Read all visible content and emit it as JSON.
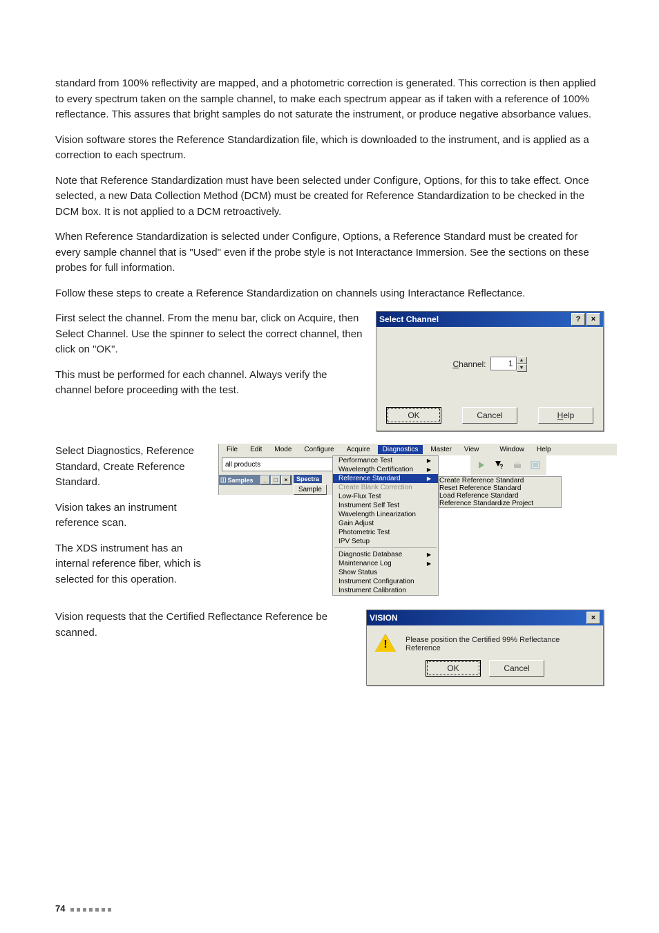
{
  "paragraphs": {
    "p1": "standard from 100% reflectivity are mapped, and a photometric correction is generated. This correction is then applied to every spectrum taken on the sample channel, to make each spectrum appear as if taken with a reference of 100% reflectance. This assures that bright samples do not saturate the instrument, or produce negative absorbance values.",
    "p2": "Vision software stores the Reference Standardization file, which is downloaded to the instrument, and is applied as a correction to each spectrum.",
    "p3": "Note that Reference Standardization must have been selected under Configure, Options, for this to take effect. Once selected, a new Data Collection Method (DCM) must be created for Reference Standardization to be checked in the DCM box. It is not applied to a DCM retroactively.",
    "p4": "When Reference Standardization is selected under Configure, Options, a Reference Standard must be created for every sample channel that is \"Used\" even if the probe style is not Interactance Immersion. See the sections on these probes for full information.",
    "p5": "Follow these steps to create a Reference Standardization on channels using Interactance Reflectance.",
    "p6": "First select the channel. From the menu bar, click on Acquire, then Select Channel. Use the spinner to select the correct channel, then click on \"OK\".",
    "p7": "This must be performed for each channel. Always verify the channel before proceeding with the test.",
    "p8": "Select Diagnostics, Reference Standard, Create Reference Standard.",
    "p9": "Vision takes an instrument reference scan.",
    "p10": "The XDS instrument has an internal reference fiber, which is selected for this operation.",
    "p11": "Vision requests that the Certified Reflectance Reference be scanned."
  },
  "select_channel": {
    "title": "Select Channel",
    "label_pre": "C",
    "label_post": "hannel:",
    "value": "1",
    "ok": "OK",
    "cancel": "Cancel",
    "help_pre": "H",
    "help_post": "elp"
  },
  "app": {
    "menubar": {
      "file": "File",
      "edit": "Edit",
      "mode": "Mode",
      "configure": "Configure",
      "acquire": "Acquire",
      "diagnostics": "Diagnostics",
      "master": "Master",
      "view": "View",
      "window": "Window",
      "help": "Help"
    },
    "combo": "all products",
    "mdi": {
      "title": "Samples",
      "spectra_tab": "Spectra",
      "sample_btn": "Sample"
    },
    "diag_menu": {
      "performance": "Performance Test",
      "wavelength_cert": "Wavelength Certification",
      "ref_std": "Reference Standard",
      "blank": "Create Blank Correction",
      "lowflux": "Low-Flux Test",
      "selftest": "Instrument Self Test",
      "wl_lin": "Wavelength Linearization",
      "gain": "Gain Adjust",
      "photo": "Photometric Test",
      "ipv": "IPV Setup",
      "db": "Diagnostic Database",
      "maint": "Maintenance Log",
      "status": "Show Status",
      "config": "Instrument Configuration",
      "calib": "Instrument Calibration"
    },
    "ref_submenu": {
      "create": "Create Reference Standard",
      "reset": "Reset Reference Standard",
      "load": "Load Reference Standard",
      "project": "Reference Standardize Project"
    }
  },
  "vision_dialog": {
    "title": "VISION",
    "msg": "Please position the Certified 99% Reflectance Reference",
    "ok": "OK",
    "cancel": "Cancel"
  },
  "footer": {
    "page": "74"
  }
}
